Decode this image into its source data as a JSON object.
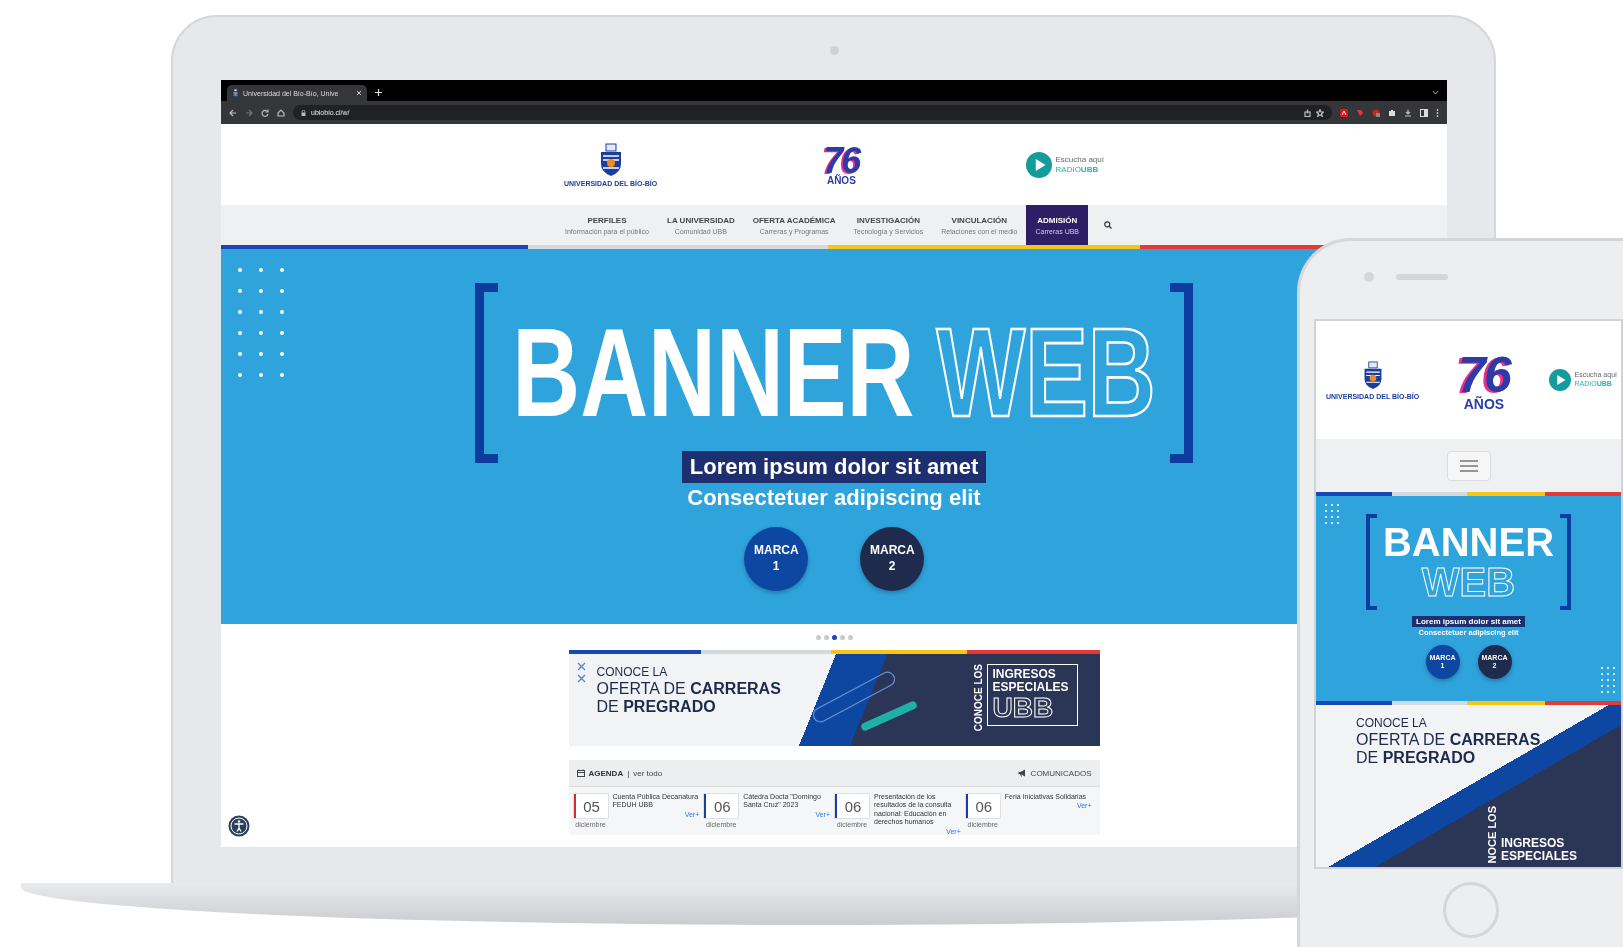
{
  "browser": {
    "tab_title": "Universidad del Bío-Bío, Unive",
    "url": "ubiobio.cl/w/"
  },
  "header": {
    "university_name": "UNIVERSIDAD DEL BÍO-BÍO",
    "anniversary_number": "76",
    "anniversary_word": "AÑOS",
    "radio_line1": "Escucha aquí",
    "radio_line2": "RADIO**UBB**"
  },
  "nav": [
    {
      "title": "PERFILES",
      "subtitle": "Información para el público",
      "selected": false
    },
    {
      "title": "LA UNIVERSIDAD",
      "subtitle": "Comunidad UBB",
      "selected": false
    },
    {
      "title": "OFERTA ACADÉMICA",
      "subtitle": "Carreras y Programas",
      "selected": false
    },
    {
      "title": "INVESTIGACIÓN",
      "subtitle": "Tecnología y Servicios",
      "selected": false
    },
    {
      "title": "VINCULACIÓN",
      "subtitle": "Relaciones con el medio",
      "selected": false
    },
    {
      "title": "ADMISIÓN",
      "subtitle": "Carreras UBB",
      "selected": true
    }
  ],
  "banner": {
    "title_solid": "BANNER",
    "title_outline": "WEB",
    "subtitle_1": "Lorem ipsum dolor sit amet",
    "subtitle_2": "Consectetuer adipiscing elit",
    "buttons": [
      {
        "label": "MARCA 1",
        "color": "#0d47a1"
      },
      {
        "label": "MARCA 2",
        "color": "#1f2b4d"
      }
    ]
  },
  "carousel_dots": [
    {
      "selected": false
    },
    {
      "selected": false
    },
    {
      "selected": true
    },
    {
      "selected": false
    },
    {
      "selected": false
    }
  ],
  "promo": {
    "line_1": "CONOCE LA",
    "line_2": "OFERTA DE **CARRERAS**",
    "line_3": "DE **PREGRADO**",
    "side_vertical": "CONOCE LOS",
    "side_lines": [
      "INGRESOS",
      "ESPECIALES"
    ],
    "side_big": "UBB"
  },
  "agenda": {
    "title": "AGENDA",
    "separator": "|",
    "link": "ver todo",
    "comunicados": "COMUNICADOS",
    "events": [
      {
        "day": "05",
        "month": "diciembre",
        "text": "Cuenta Pública Decanatura FEDUH UBB",
        "more": "Ver+",
        "color": "#d32f2f"
      },
      {
        "day": "06",
        "month": "diciembre",
        "text": "Cátedra Docta \"Domingo Santa Cruz\" 2023",
        "more": "Ver+",
        "color": "#1a3ea8"
      },
      {
        "day": "06",
        "month": "diciembre",
        "text": "Presentación de los resultados de la consulta nacional: Educación en derechos humanos",
        "more": "Ver+",
        "color": "#1a3ea8"
      },
      {
        "day": "06",
        "month": "diciembre",
        "text": "Feria Iniciativas Solidarias",
        "more": "Ver+",
        "color": "#1a3ea8"
      }
    ]
  },
  "phone": {
    "header": {
      "university_name": "UNIVERSIDAD DEL BÍO-BÍO",
      "anniversary_number": "76",
      "anniversary_word": "AÑOS",
      "radio_line1": "Escucha aquí",
      "radio_line2": "RADIO**UBB**"
    },
    "banner": {
      "title_solid": "BANNER",
      "title_outline": "WEB",
      "subtitle_1": "Lorem ipsum dolor sit amet",
      "subtitle_2": "Consectetuer adipiscing elit",
      "buttons": [
        {
          "label": "MARCA 1",
          "color": "#0d47a1"
        },
        {
          "label": "MARCA 2",
          "color": "#1f2b4d"
        }
      ]
    },
    "promo": {
      "line_1": "CONOCE LA",
      "line_2": "OFERTA DE **CARRERAS**",
      "line_3": "DE **PREGRADO**",
      "side_vertical": "NOCE LOS",
      "side_lines": [
        "INGRESOS",
        "ESPECIALES"
      ]
    }
  }
}
